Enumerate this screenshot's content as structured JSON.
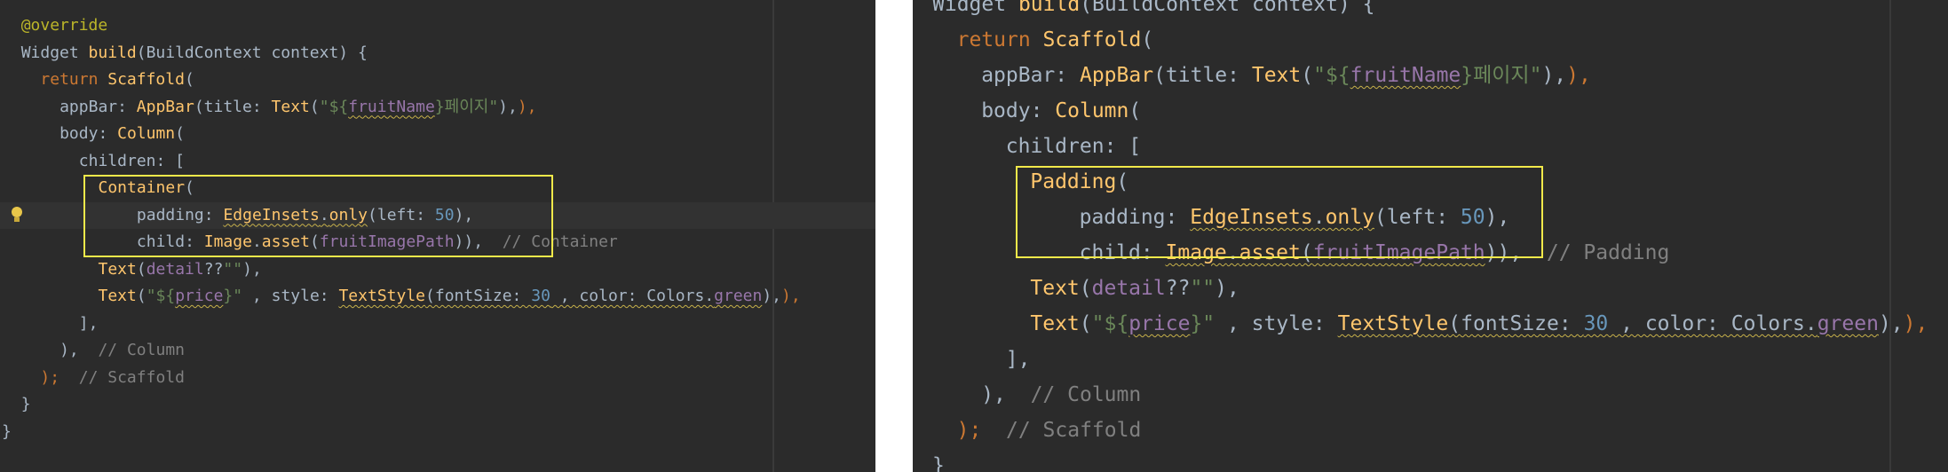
{
  "left_panel": {
    "lines": [
      {
        "indent": 1,
        "tokens": [
          {
            "t": "@override",
            "c": "ann"
          }
        ]
      },
      {
        "indent": 1,
        "tokens": [
          {
            "t": "Widget ",
            "c": ""
          },
          {
            "t": "build",
            "c": "fn"
          },
          {
            "t": "(BuildContext context) {",
            "c": ""
          }
        ]
      },
      {
        "indent": 2,
        "tokens": [
          {
            "t": "return ",
            "c": "kw"
          },
          {
            "t": "Scaffold",
            "c": "fn"
          },
          {
            "t": "(",
            "c": ""
          }
        ]
      },
      {
        "indent": 3,
        "tokens": [
          {
            "t": "appBar: ",
            "c": ""
          },
          {
            "t": "AppBar",
            "c": "fn"
          },
          {
            "t": "(title: ",
            "c": ""
          },
          {
            "t": "Text",
            "c": "fn"
          },
          {
            "t": "(",
            "c": ""
          },
          {
            "t": "\"${",
            "c": "str"
          },
          {
            "t": "fruitName",
            "c": "var sq"
          },
          {
            "t": "}페이지\"",
            "c": "str"
          },
          {
            "t": "),",
            "c": ""
          },
          {
            "t": "),",
            "c": "kw"
          }
        ]
      },
      {
        "indent": 3,
        "tokens": [
          {
            "t": "body: ",
            "c": ""
          },
          {
            "t": "Column",
            "c": "fn"
          },
          {
            "t": "(",
            "c": ""
          }
        ]
      },
      {
        "indent": 4,
        "tokens": [
          {
            "t": "children: [",
            "c": ""
          }
        ]
      },
      {
        "indent": 5,
        "tokens": [
          {
            "t": "Container",
            "c": "fn"
          },
          {
            "t": "(",
            "c": ""
          }
        ]
      },
      {
        "indent": 7,
        "tokens": [
          {
            "t": "padding: ",
            "c": ""
          },
          {
            "t": "EdgeInsets",
            "c": "fn sq"
          },
          {
            "t": ".",
            "c": "sq"
          },
          {
            "t": "only",
            "c": "fn sq"
          },
          {
            "t": "(left: ",
            "c": ""
          },
          {
            "t": "50",
            "c": "num"
          },
          {
            "t": "),",
            "c": ""
          }
        ]
      },
      {
        "indent": 7,
        "tokens": [
          {
            "t": "child: ",
            "c": ""
          },
          {
            "t": "Image",
            "c": "fn"
          },
          {
            "t": ".",
            "c": ""
          },
          {
            "t": "asset",
            "c": "fn"
          },
          {
            "t": "(",
            "c": ""
          },
          {
            "t": "fruitImagePath",
            "c": "var"
          },
          {
            "t": ")),",
            "c": ""
          },
          {
            "t": "  // Container",
            "c": "cm"
          }
        ]
      },
      {
        "indent": 5,
        "tokens": [
          {
            "t": "Text",
            "c": "fn"
          },
          {
            "t": "(",
            "c": ""
          },
          {
            "t": "detail",
            "c": "var"
          },
          {
            "t": "??",
            "c": ""
          },
          {
            "t": "\"\"",
            "c": "str"
          },
          {
            "t": "),",
            "c": ""
          }
        ]
      },
      {
        "indent": 5,
        "tokens": [
          {
            "t": "Text",
            "c": "fn"
          },
          {
            "t": "(",
            "c": ""
          },
          {
            "t": "\"${",
            "c": "str"
          },
          {
            "t": "price",
            "c": "var sq"
          },
          {
            "t": "}\"",
            "c": "str"
          },
          {
            "t": " , style: ",
            "c": ""
          },
          {
            "t": "TextStyle",
            "c": "fn sq"
          },
          {
            "t": "(fontSize: ",
            "c": "sq"
          },
          {
            "t": "30",
            "c": "num sq"
          },
          {
            "t": " , color: Colors.",
            "c": "sq"
          },
          {
            "t": "green",
            "c": "var sq"
          },
          {
            "t": "),",
            "c": ""
          },
          {
            "t": "),",
            "c": "kw"
          }
        ]
      },
      {
        "indent": 4,
        "tokens": [
          {
            "t": "],",
            "c": ""
          }
        ]
      },
      {
        "indent": 3,
        "tokens": [
          {
            "t": "),",
            "c": ""
          },
          {
            "t": "  // Column",
            "c": "cm"
          }
        ]
      },
      {
        "indent": 2,
        "tokens": [
          {
            "t": ");",
            "c": "kw"
          },
          {
            "t": "  // Scaffold",
            "c": "cm"
          }
        ]
      },
      {
        "indent": 1,
        "tokens": [
          {
            "t": "}",
            "c": ""
          }
        ]
      },
      {
        "indent": 0,
        "tokens": [
          {
            "t": "}",
            "c": ""
          }
        ]
      }
    ]
  },
  "right_panel": {
    "lines": [
      {
        "indent": 0,
        "tokens": [
          {
            "t": "Widget ",
            "c": ""
          },
          {
            "t": "build",
            "c": "fn"
          },
          {
            "t": "(BuildContext context) {",
            "c": ""
          }
        ]
      },
      {
        "indent": 1,
        "tokens": [
          {
            "t": "return ",
            "c": "kw"
          },
          {
            "t": "Scaffold",
            "c": "fn"
          },
          {
            "t": "(",
            "c": ""
          }
        ]
      },
      {
        "indent": 2,
        "tokens": [
          {
            "t": "appBar: ",
            "c": ""
          },
          {
            "t": "AppBar",
            "c": "fn"
          },
          {
            "t": "(title: ",
            "c": ""
          },
          {
            "t": "Text",
            "c": "fn"
          },
          {
            "t": "(",
            "c": ""
          },
          {
            "t": "\"${",
            "c": "str"
          },
          {
            "t": "fruitName",
            "c": "var sq"
          },
          {
            "t": "}페이지\"",
            "c": "str"
          },
          {
            "t": "),",
            "c": ""
          },
          {
            "t": "),",
            "c": "kw"
          }
        ]
      },
      {
        "indent": 2,
        "tokens": [
          {
            "t": "body: ",
            "c": ""
          },
          {
            "t": "Column",
            "c": "fn"
          },
          {
            "t": "(",
            "c": ""
          }
        ]
      },
      {
        "indent": 3,
        "tokens": [
          {
            "t": "children: [",
            "c": ""
          }
        ]
      },
      {
        "indent": 4,
        "tokens": [
          {
            "t": "Padding",
            "c": "fn"
          },
          {
            "t": "(",
            "c": ""
          }
        ]
      },
      {
        "indent": 6,
        "tokens": [
          {
            "t": "padding: ",
            "c": ""
          },
          {
            "t": "EdgeInsets",
            "c": "fn sq"
          },
          {
            "t": ".",
            "c": "sq"
          },
          {
            "t": "only",
            "c": "fn sq"
          },
          {
            "t": "(left: ",
            "c": ""
          },
          {
            "t": "50",
            "c": "num"
          },
          {
            "t": "),",
            "c": ""
          }
        ]
      },
      {
        "indent": 6,
        "tokens": [
          {
            "t": "child: ",
            "c": ""
          },
          {
            "t": "Image",
            "c": "fn sq"
          },
          {
            "t": ".",
            "c": "sq"
          },
          {
            "t": "asset",
            "c": "fn sq"
          },
          {
            "t": "(",
            "c": "sq"
          },
          {
            "t": "fruitImagePath",
            "c": "var sq"
          },
          {
            "t": ")),",
            "c": ""
          },
          {
            "t": "  // Padding",
            "c": "cm"
          }
        ]
      },
      {
        "indent": 4,
        "tokens": [
          {
            "t": "Text",
            "c": "fn"
          },
          {
            "t": "(",
            "c": ""
          },
          {
            "t": "detail",
            "c": "var"
          },
          {
            "t": "??",
            "c": ""
          },
          {
            "t": "\"\"",
            "c": "str"
          },
          {
            "t": "),",
            "c": ""
          }
        ]
      },
      {
        "indent": 4,
        "tokens": [
          {
            "t": "Text",
            "c": "fn"
          },
          {
            "t": "(",
            "c": ""
          },
          {
            "t": "\"${",
            "c": "str"
          },
          {
            "t": "price",
            "c": "var sq"
          },
          {
            "t": "}\"",
            "c": "str"
          },
          {
            "t": " , style: ",
            "c": ""
          },
          {
            "t": "TextStyle",
            "c": "fn sq"
          },
          {
            "t": "(fontSize: ",
            "c": "sq"
          },
          {
            "t": "30",
            "c": "num sq"
          },
          {
            "t": " , color: Colors.",
            "c": "sq"
          },
          {
            "t": "green",
            "c": "var sq"
          },
          {
            "t": "),",
            "c": ""
          },
          {
            "t": "),",
            "c": "kw"
          }
        ]
      },
      {
        "indent": 3,
        "tokens": [
          {
            "t": "],",
            "c": ""
          }
        ]
      },
      {
        "indent": 2,
        "tokens": [
          {
            "t": "),",
            "c": ""
          },
          {
            "t": "  // Column",
            "c": "cm"
          }
        ]
      },
      {
        "indent": 1,
        "tokens": [
          {
            "t": ");",
            "c": "kw"
          },
          {
            "t": "  // Scaffold",
            "c": "cm"
          }
        ]
      },
      {
        "indent": 0,
        "tokens": [
          {
            "t": "}",
            "c": ""
          }
        ]
      }
    ]
  },
  "colors": {
    "editor_background": "#2b2b2b",
    "highlight_box": "#f2e94a",
    "keyword": "#cc7832",
    "function": "#ffc66d",
    "string": "#6a8759",
    "number": "#6897bb",
    "field": "#9876aa",
    "comment": "#808080"
  },
  "icons": {
    "left_gutter": "lightbulb-icon"
  }
}
